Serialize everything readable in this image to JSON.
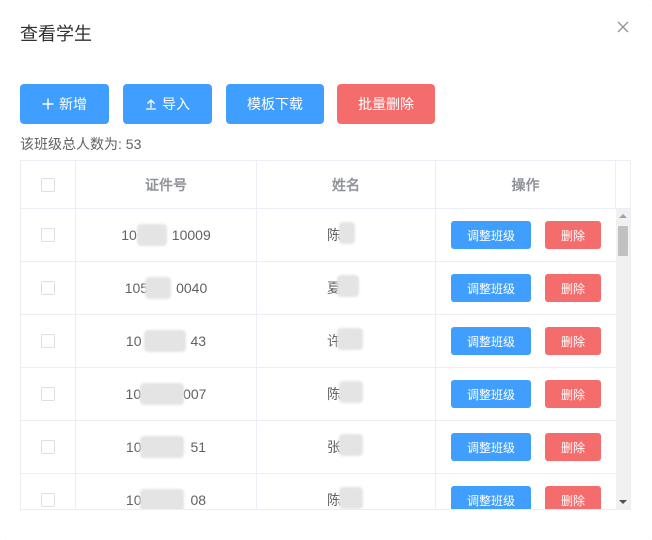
{
  "dialog": {
    "title": "查看学生"
  },
  "toolbar": {
    "add_label": "新增",
    "import_label": "导入",
    "template_label": "模板下载",
    "batch_delete_label": "批量删除"
  },
  "summary": {
    "total_text": "该班级总人数为: 53"
  },
  "table": {
    "headers": {
      "id": "证件号",
      "name": "姓名",
      "action": "操作"
    },
    "rows": [
      {
        "id": "10     10009",
        "name": "陈",
        "adjust": "调整班级",
        "delete": "删除"
      },
      {
        "id": "105    0040",
        "name": "夏",
        "adjust": "调整班级",
        "delete": "删除"
      },
      {
        "id": "10       43",
        "name": "许",
        "adjust": "调整班级",
        "delete": "删除"
      },
      {
        "id": "10      007",
        "name": "陈",
        "adjust": "调整班级",
        "delete": "删除"
      },
      {
        "id": "10       51",
        "name": "张",
        "adjust": "调整班级",
        "delete": "删除"
      },
      {
        "id": "10       08",
        "name": "陈",
        "adjust": "调整班级",
        "delete": "删除"
      }
    ]
  },
  "colors": {
    "primary": "#409eff",
    "danger": "#f56c6c",
    "border": "#ebeef5",
    "header_text": "#909399",
    "body_text": "#606266"
  },
  "icons": {
    "close": "close-icon",
    "add": "plus-icon",
    "import": "upload-icon"
  }
}
